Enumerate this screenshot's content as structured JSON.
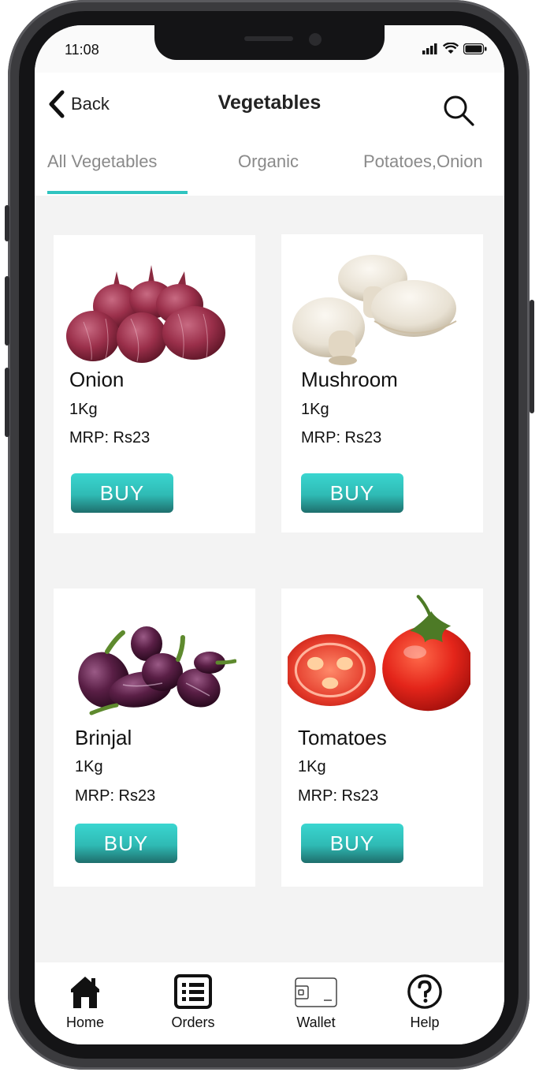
{
  "status_bar": {
    "time": "11:08"
  },
  "header": {
    "back_label": "Back",
    "title": "Vegetables"
  },
  "tabs": [
    {
      "label": "All Vegetables",
      "active": true
    },
    {
      "label": "Organic",
      "active": false
    },
    {
      "label": "Potatoes,Onion",
      "active": false
    }
  ],
  "products": [
    {
      "name": "Onion",
      "qty": "1Kg",
      "price": "MRP: Rs23",
      "buy_label": "BUY",
      "image": "onion-image"
    },
    {
      "name": "Mushroom",
      "qty": "1Kg",
      "price": "MRP: Rs23",
      "buy_label": "BUY",
      "image": "mushroom-image"
    },
    {
      "name": "Brinjal",
      "qty": "1Kg",
      "price": "MRP: Rs23",
      "buy_label": "BUY",
      "image": "brinjal-image"
    },
    {
      "name": "Tomatoes",
      "qty": "1Kg",
      "price": "MRP: Rs23",
      "buy_label": "BUY",
      "image": "tomato-image"
    }
  ],
  "bottom_nav": [
    {
      "label": "Home",
      "icon": "home-icon"
    },
    {
      "label": "Orders",
      "icon": "orders-list-icon"
    },
    {
      "label": "Wallet",
      "icon": "wallet-icon"
    },
    {
      "label": "Help",
      "icon": "help-icon"
    }
  ],
  "colors": {
    "accent": "#2fc4c0",
    "buy_button_top": "#3ad6d0",
    "buy_button_bottom": "#1e6e6c",
    "background": "#f3f3f3",
    "phone_frame": "#3b3b3e"
  }
}
